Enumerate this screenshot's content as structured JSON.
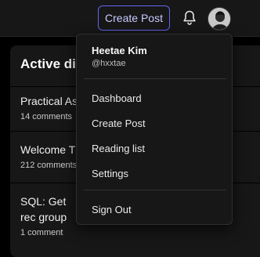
{
  "header": {
    "create_post_label": "Create Post",
    "notifications_icon": "bell-icon",
    "avatar_icon": "user-avatar"
  },
  "discussions": {
    "title": "Active discussions",
    "items": [
      {
        "title": "Practical Asy",
        "comments": "14 comments"
      },
      {
        "title": "Welcome Th",
        "comments": "212 comments"
      },
      {
        "title": "SQL: Get rec group",
        "comments": "1 comment"
      }
    ]
  },
  "user_menu": {
    "name": "Heetae Kim",
    "handle": "@hxxtae",
    "items": [
      {
        "label": "Dashboard"
      },
      {
        "label": "Create Post"
      },
      {
        "label": "Reading list"
      },
      {
        "label": "Settings"
      }
    ],
    "sign_out_label": "Sign Out"
  },
  "colors": {
    "accent": "#6366f1",
    "background": "#000000",
    "surface": "#171717"
  }
}
